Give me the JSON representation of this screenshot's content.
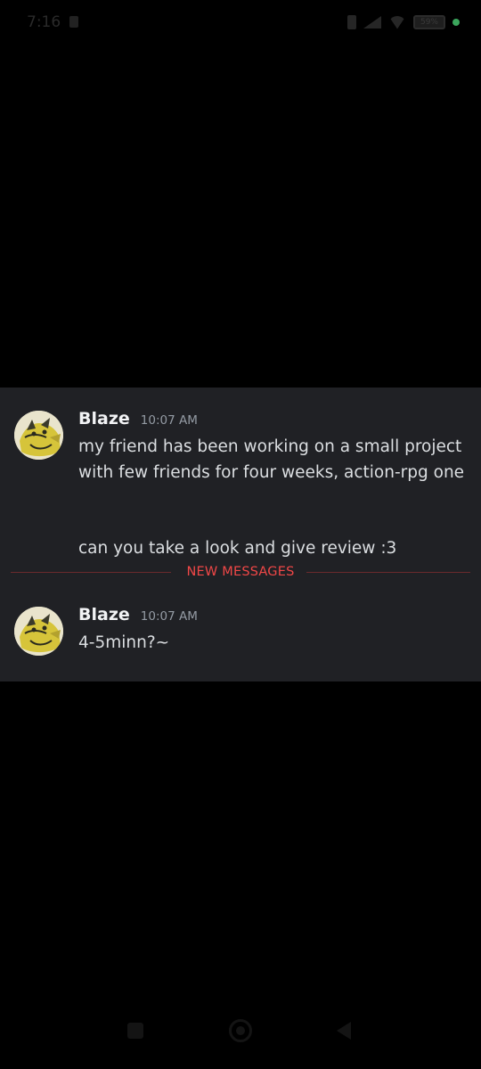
{
  "status_bar": {
    "time": "7:16",
    "battery": "59%",
    "icons": [
      "sim-icon",
      "bluetooth-icon",
      "signal-icon",
      "wifi-icon",
      "battery-icon",
      "status-dot"
    ],
    "dot_color": "#3ba55c"
  },
  "messages": [
    {
      "author": "Blaze",
      "timestamp": "10:07 AM",
      "lines": [
        "my friend has been working on a small project with few friends for four weeks, action-rpg one",
        "can you take a look and give review :3"
      ]
    },
    {
      "author": "Blaze",
      "timestamp": "10:07 AM",
      "lines": [
        "4-5minn?~"
      ]
    }
  ],
  "divider": {
    "label": "NEW MESSAGES",
    "color": "#f04747"
  },
  "colors": {
    "panel_bg": "#202125",
    "page_bg": "#000000",
    "author": "#f2f3f5",
    "timestamp": "#949ba4",
    "body_text": "#dbdee1"
  },
  "nav_bar": {
    "icons": [
      "recents-icon",
      "home-icon",
      "back-icon"
    ]
  }
}
